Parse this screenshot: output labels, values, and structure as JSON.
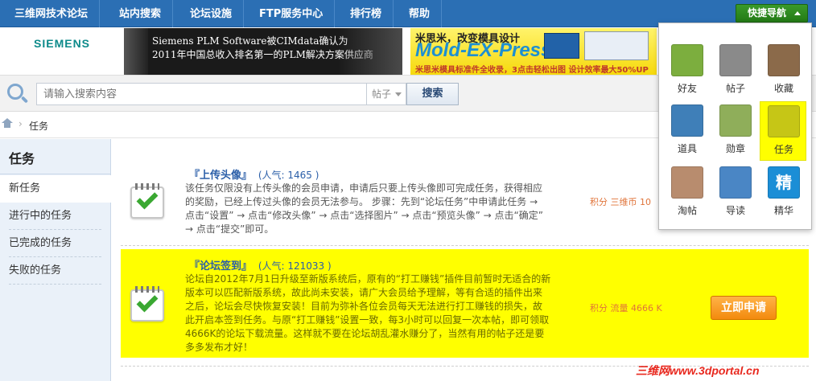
{
  "nav": {
    "items": [
      "三维网技术论坛",
      "站内搜索",
      "论坛设施",
      "FTP服务中心",
      "排行榜",
      "帮助"
    ],
    "quick_nav_label": "快捷导航"
  },
  "banners": {
    "siemens_logo": "SIEMENS",
    "siemens_line1": "Siemens PLM Software被CIMdata确认为",
    "siemens_line2": "2011年中国总收入排名第一的PLM解决方案供应商",
    "mold_line1": "米思米，改变模具设计",
    "mold_brand": "Mold-EX-Press",
    "mold_line3": "米思米模具标准件全收录，3点击轻松出图 设计效率最大50%UP"
  },
  "search": {
    "placeholder": "请输入搜索内容",
    "type_label": "帖子",
    "button_label": "搜索"
  },
  "breadcrumb": {
    "current": "任务",
    "separator": "›"
  },
  "sidebar": {
    "title": "任务",
    "items": [
      "新任务",
      "进行中的任务",
      "已完成的任务",
      "失败的任务"
    ],
    "active": "新任务"
  },
  "tasks": [
    {
      "name": "『上传头像』",
      "popularity": "(人气: 1465 )",
      "desc_lines": [
        "该任务仅限没有上传头像的会员申请，申请后只要上传头像即可完成任务，获得相应",
        "的奖励，已经上传过头像的会员无法参与。 步骤：先到“论坛任务”中申请此任务 →",
        "点击“设置” → 点击“修改头像” → 点击“选择图片” → 点击“预览头像” → 点击“确定”",
        "→ 点击“提交”即可。"
      ],
      "reward": "积分 三维币 10"
    },
    {
      "name": "『论坛签到』",
      "popularity": "(人气: 121033 )",
      "desc_lines": [
        "论坛自2012年7月1日升级至新版系统后，原有的“打工赚钱”插件目前暂时无适合的新",
        "版本可以匹配新版系统，故此尚未安装，请广大会员给予理解，等有合适的插件出来",
        "之后，论坛会尽快恢复安装！目前为弥补各位会员每天无法进行打工赚钱的损失，故",
        "此开启本签到任务。与原“打工赚钱”设置一致，每3小时可以回复一次本帖，即可领取",
        "4666K的论坛下载流量。这样就不要在论坛胡乱灌水赚分了，当然有用的帖子还是要",
        "多多发布才好！"
      ],
      "reward": "积分 流量 4666 K",
      "apply_label": "立即申请"
    }
  ],
  "quick_nav": {
    "tiles": [
      {
        "label": "好友",
        "icon": "friends-icon",
        "color": "#7cae3e"
      },
      {
        "label": "帖子",
        "icon": "posts-icon",
        "color": "#8a8a8a"
      },
      {
        "label": "收藏",
        "icon": "favorites-icon",
        "color": "#8b6a4a"
      },
      {
        "label": "道具",
        "icon": "magic-wand-icon",
        "color": "#3f7fb8"
      },
      {
        "label": "勋章",
        "icon": "medal-icon",
        "color": "#8fae5a"
      },
      {
        "label": "任务",
        "icon": "task-icon",
        "color": "#c6c616"
      },
      {
        "label": "淘帖",
        "icon": "inbox-icon",
        "color": "#b88c6e"
      },
      {
        "label": "导读",
        "icon": "guide-icon",
        "color": "#4a86c5"
      },
      {
        "label": "精华",
        "icon": "essence-icon",
        "color": "#1b8ed6",
        "glyph": "精"
      }
    ],
    "selected": "任务"
  },
  "watermark": "三维网www.3dportal.cn"
}
